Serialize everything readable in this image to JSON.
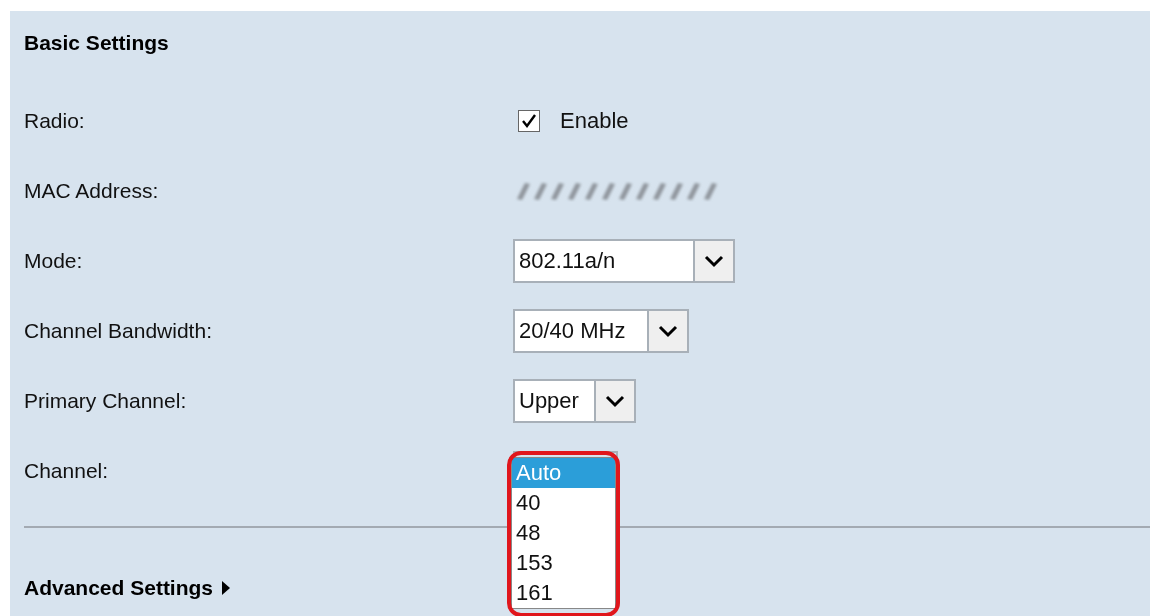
{
  "section": {
    "title": "Basic Settings"
  },
  "fields": [
    {
      "kind": "checkbox",
      "label": "Radio:",
      "checked": true,
      "option": "Enable"
    },
    {
      "kind": "masked",
      "label": "MAC Address:"
    },
    {
      "kind": "select",
      "label": "Mode:",
      "value": "802.11a/n",
      "open": false
    },
    {
      "kind": "select",
      "label": "Channel Bandwidth:",
      "value": "20/40 MHz",
      "open": false
    },
    {
      "kind": "select",
      "label": "Primary Channel:",
      "value": "Upper",
      "open": false
    },
    {
      "kind": "select",
      "label": "Channel:",
      "open": true,
      "options": [
        {
          "label": "Auto",
          "selected": true
        },
        {
          "label": "40",
          "selected": false
        },
        {
          "label": "48",
          "selected": false
        },
        {
          "label": "153",
          "selected": false
        },
        {
          "label": "161",
          "selected": false
        }
      ]
    }
  ],
  "advanced": {
    "title": "Advanced Settings",
    "expanded": false
  }
}
